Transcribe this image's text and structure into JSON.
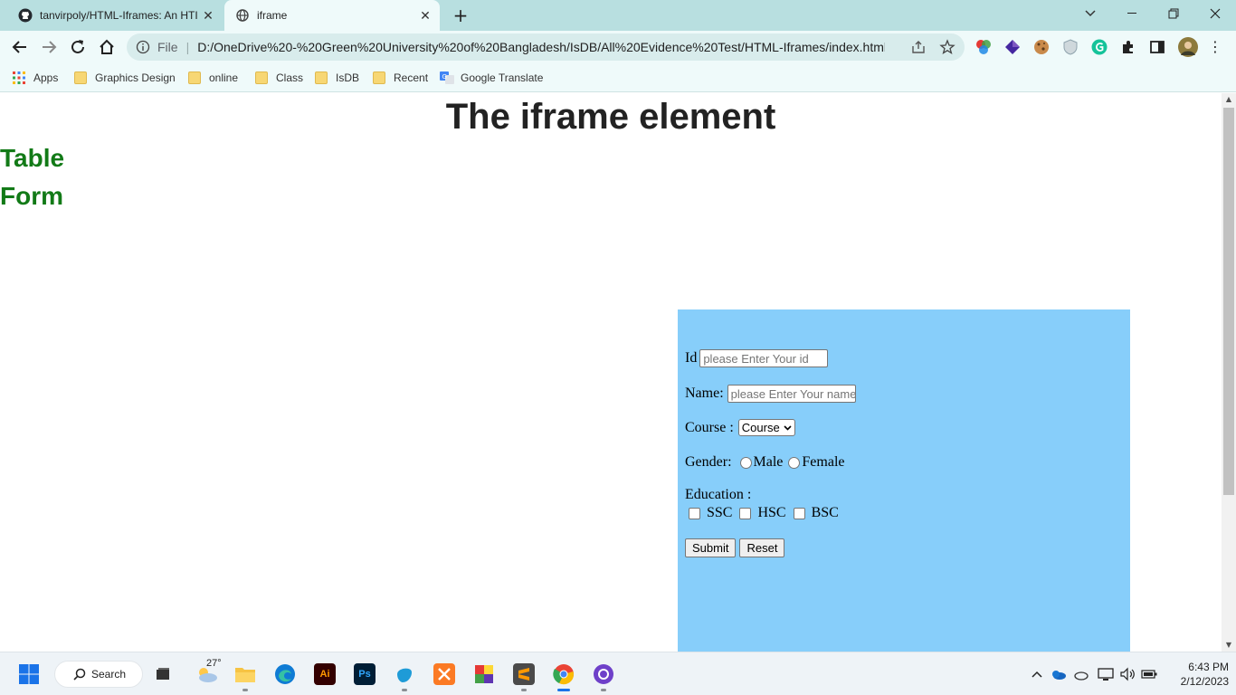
{
  "browser": {
    "tabs": [
      {
        "title": "tanvirpoly/HTML-Iframes: An HTI",
        "icon": "github-icon",
        "active": false
      },
      {
        "title": "iframe",
        "icon": "globe-icon",
        "active": true
      }
    ],
    "omnibox": {
      "scheme": "File",
      "url": "D:/OneDrive%20-%20Green%20University%20of%20Bangladesh/IsDB/All%20Evidence%20Test/HTML-Iframes/index.html"
    },
    "bookmarks": [
      {
        "label": "Apps",
        "icon": "apps-grid-icon"
      },
      {
        "label": "Graphics Design",
        "icon": "folder-icon"
      },
      {
        "label": "online",
        "icon": "folder-icon"
      },
      {
        "label": "Class",
        "icon": "folder-icon"
      },
      {
        "label": "IsDB",
        "icon": "folder-icon"
      },
      {
        "label": "Recent",
        "icon": "folder-icon"
      },
      {
        "label": "Google Translate",
        "icon": "google-translate-icon"
      }
    ]
  },
  "page": {
    "title": "The iframe element",
    "links": [
      "Table",
      "Form"
    ],
    "link_color": "#127a17"
  },
  "form": {
    "background": "#87cefa",
    "id_label": "Id",
    "id_placeholder": "please Enter Your id",
    "name_label": "Name:",
    "name_placeholder": "please Enter Your name",
    "course_label": "Course :",
    "course_selected": "Course",
    "gender_label": "Gender:",
    "gender_options": [
      "Male",
      "Female"
    ],
    "education_label": "Education :",
    "education_options": [
      "SSC",
      "HSC",
      "BSC"
    ],
    "submit_label": "Submit",
    "reset_label": "Reset"
  },
  "taskbar": {
    "search_label": "Search",
    "weather_temp": "27°",
    "time": "6:43 PM",
    "date": "2/12/2023"
  }
}
